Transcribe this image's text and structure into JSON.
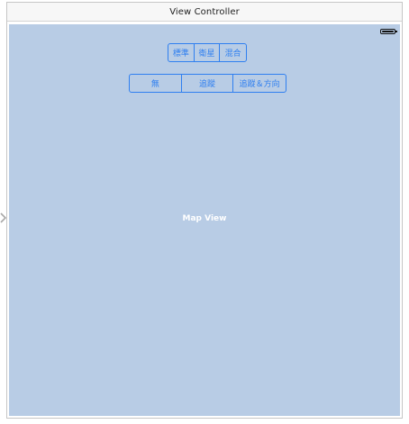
{
  "window": {
    "title": "View Controller"
  },
  "map_view": {
    "label": "Map View",
    "background_color": "#b8cce5"
  },
  "map_type_control": {
    "segments": [
      "標準",
      "衛星",
      "混合"
    ]
  },
  "tracking_control": {
    "segments": [
      "無",
      "追蹤",
      "追蹤＆方向"
    ]
  },
  "colors": {
    "accent": "#2f7ff0",
    "label": "#ffffff"
  },
  "icons": {
    "battery": "battery-icon",
    "entry_point": "entry-point-arrow-icon"
  }
}
